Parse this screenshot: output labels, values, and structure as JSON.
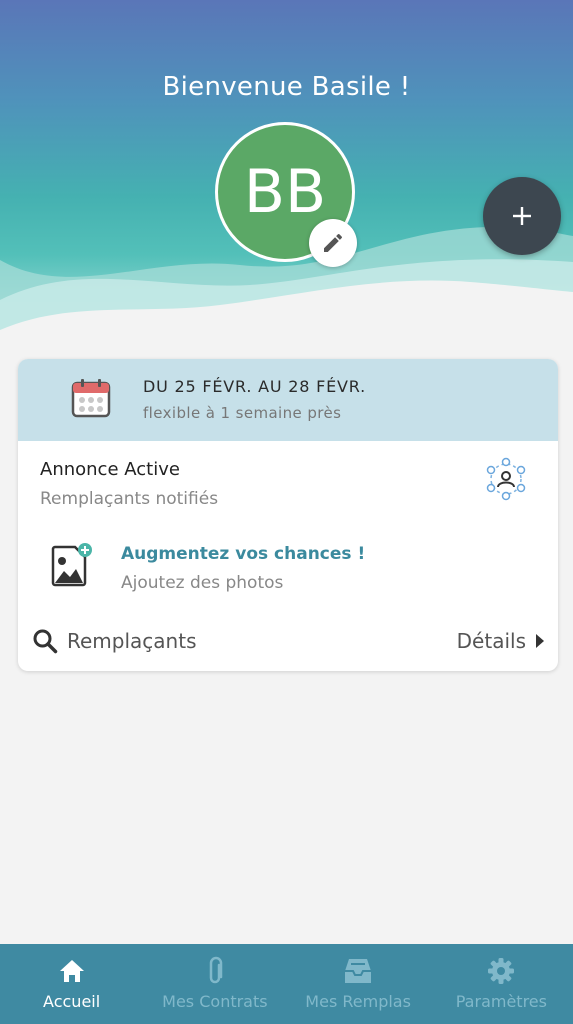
{
  "header": {
    "welcome": "Bienvenue Basile !",
    "avatar_initials": "BB"
  },
  "fab": {
    "icon": "plus-icon",
    "label": "+"
  },
  "card": {
    "dates": "DU 25 FÉVR. AU 28 FÉVR.",
    "flexibility": "flexible à 1 semaine près",
    "status_title": "Annonce Active",
    "status_sub": "Remplaçants notifiés",
    "promo_title": "Augmentez vos chances !",
    "promo_sub": "Ajoutez des photos",
    "search_label": "Remplaçants",
    "details_label": "Détails"
  },
  "tabs": [
    {
      "label": "Accueil",
      "icon": "home-icon",
      "active": true
    },
    {
      "label": "Mes Contrats",
      "icon": "paperclip-icon",
      "active": false
    },
    {
      "label": "Mes Remplas",
      "icon": "inbox-icon",
      "active": false
    },
    {
      "label": "Paramètres",
      "icon": "gear-icon",
      "active": false
    }
  ],
  "colors": {
    "avatar": "#5ba866",
    "fab": "#3d4750",
    "tabbar": "#3f8aa2",
    "card_header": "#c6e0e9",
    "promo_text": "#3b8a9e"
  }
}
